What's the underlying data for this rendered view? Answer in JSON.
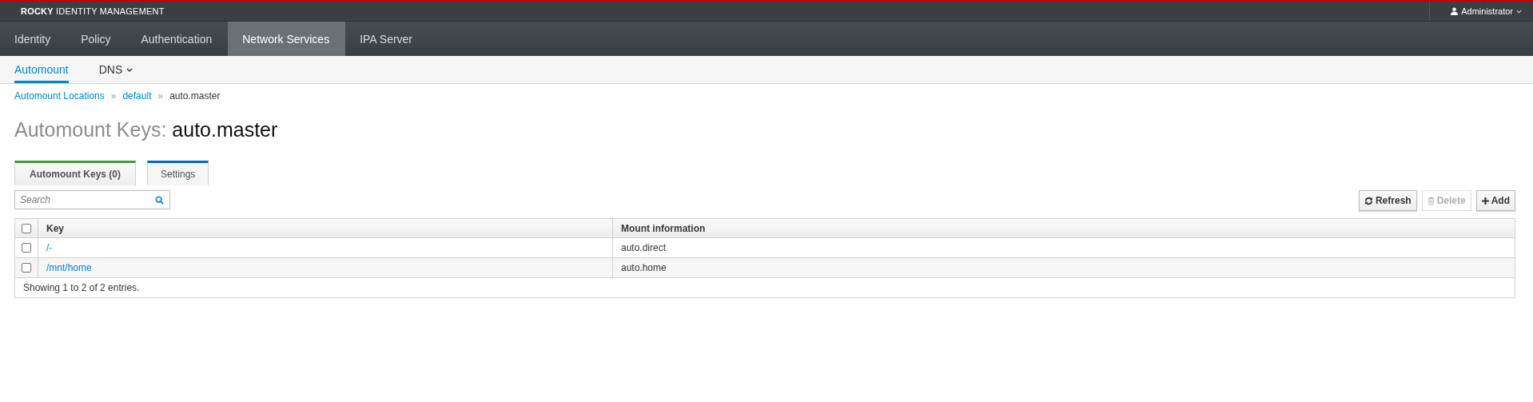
{
  "brand": {
    "bold": "ROCKY",
    "rest": "IDENTITY MANAGEMENT"
  },
  "user_menu": {
    "label": "Administrator"
  },
  "nav": [
    {
      "label": "Identity",
      "selected": false
    },
    {
      "label": "Policy",
      "selected": false
    },
    {
      "label": "Authentication",
      "selected": false
    },
    {
      "label": "Network Services",
      "selected": true
    },
    {
      "label": "IPA Server",
      "selected": false
    }
  ],
  "subnav": [
    {
      "label": "Automount",
      "selected": true,
      "dropdown": false
    },
    {
      "label": "DNS",
      "selected": false,
      "dropdown": true
    }
  ],
  "breadcrumb": [
    {
      "label": "Automount Locations",
      "link": true
    },
    {
      "separator": "»",
      "label": "default",
      "link": true
    },
    {
      "separator": "»",
      "label": "auto.master",
      "link": false
    }
  ],
  "title": {
    "prefix": "Automount Keys:",
    "name": "auto.master"
  },
  "tabs": [
    {
      "label": "Automount Keys (0)",
      "selected": true,
      "color": "#3f9c35"
    },
    {
      "label": "Settings",
      "selected": false,
      "color": "#0066cc"
    }
  ],
  "search": {
    "placeholder": "Search"
  },
  "actions": [
    {
      "label": "Refresh",
      "kind": "refresh",
      "disabled": false
    },
    {
      "label": "Delete",
      "kind": "delete",
      "disabled": true
    },
    {
      "label": "Add",
      "kind": "add",
      "disabled": false
    }
  ],
  "table": {
    "all_checked": false,
    "columns": [
      "Key",
      "Mount information"
    ],
    "rows": [
      {
        "key": "/-",
        "mount": "auto.direct",
        "checked": false
      },
      {
        "key": "/mnt/home",
        "mount": "auto.home",
        "checked": false
      }
    ],
    "footer": "Showing 1 to 2 of 2 entries."
  }
}
